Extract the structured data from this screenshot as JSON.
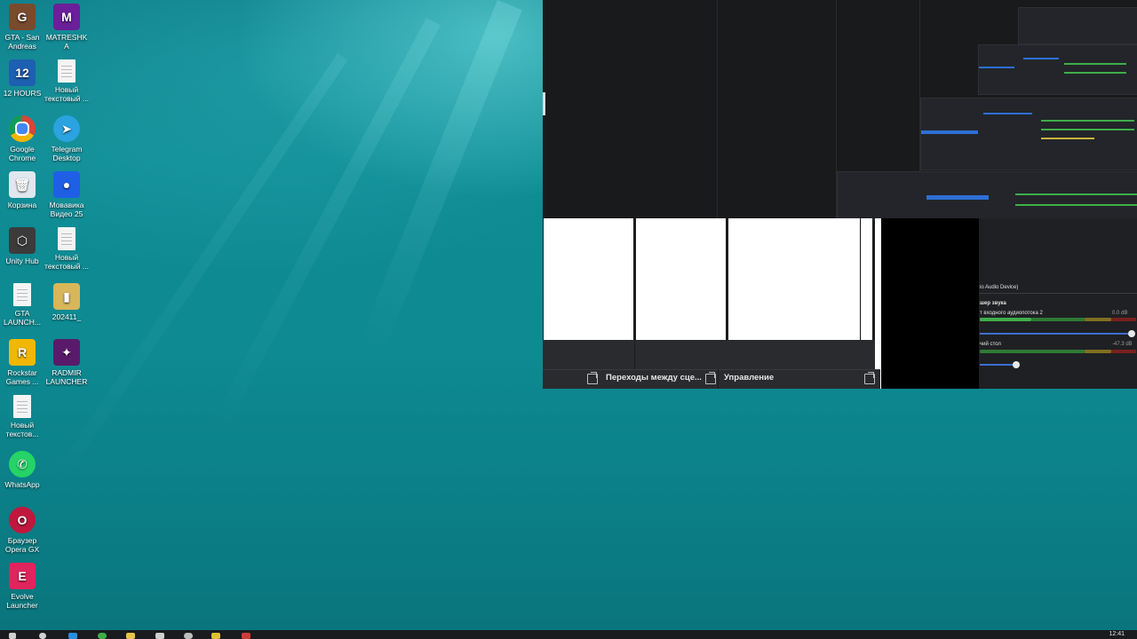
{
  "desktop": {
    "icons": [
      {
        "label": "GTA - San Andreas",
        "icon": "gta-sa-icon",
        "color": "#7a4a2e",
        "glyph": "G"
      },
      {
        "label": "MATRESHKA",
        "icon": "matreshka-icon",
        "color": "#6b1f9a",
        "glyph": "M"
      },
      {
        "label": "12 HOURS",
        "icon": "12-hours-icon",
        "color": "#1d5fb0",
        "glyph": "12"
      },
      {
        "label": "Новый текстовый ...",
        "icon": "text-file-icon",
        "color": "#f4f4f4",
        "glyph": ""
      },
      {
        "label": "Google Chrome",
        "icon": "chrome-icon",
        "color": "#db4437",
        "glyph": ""
      },
      {
        "label": "Telegram Desktop",
        "icon": "telegram-icon",
        "color": "#2aa3e0",
        "glyph": "➤"
      },
      {
        "label": "Корзина",
        "icon": "recycle-bin-icon",
        "color": "#dfe8ef",
        "glyph": "🗑"
      },
      {
        "label": "Мовавика Видео 25",
        "icon": "movavi-icon",
        "color": "#1f5fe6",
        "glyph": "●"
      },
      {
        "label": "Unity Hub",
        "icon": "unity-hub-icon",
        "color": "#3b3b3b",
        "glyph": "⬡"
      },
      {
        "label": "Новый текстовый ...",
        "icon": "text-file-icon",
        "color": "#f4f4f4",
        "glyph": ""
      },
      {
        "label": "GTA LAUNCH...",
        "icon": "file-icon",
        "color": "#f4f4f4",
        "glyph": ""
      },
      {
        "label": "202411_",
        "icon": "archive-icon",
        "color": "#d8b65a",
        "glyph": "▮"
      },
      {
        "label": "Rockstar Games ...",
        "icon": "rockstar-icon",
        "color": "#f2b705",
        "glyph": "R"
      },
      {
        "label": "RADMIR LAUNCHER",
        "icon": "radmir-icon",
        "color": "#5a1a6b",
        "glyph": "✦"
      },
      {
        "label": "Новый текстов...",
        "icon": "text-file-icon",
        "color": "#f4f4f4",
        "glyph": ""
      },
      {
        "label": "WhatsApp",
        "icon": "whatsapp-icon",
        "color": "#25d366",
        "glyph": "✆"
      },
      {
        "label": "Браузер Opera GX",
        "icon": "opera-gx-icon",
        "color": "#c0173e",
        "glyph": "O"
      },
      {
        "label": "Evolve Launcher",
        "icon": "evolve-icon",
        "color": "#e0245e",
        "glyph": "E"
      }
    ]
  },
  "obs": {
    "dock_transitions_title": "Переходы между сце...",
    "dock_controls_title": "Управление",
    "mixer_device_label": "io Audio Device)",
    "mixer_title": "шер звука",
    "mixer_track1": "т входного аудиопотока 2",
    "mixer_track2": "чий стол",
    "mixer_db1": "0.0 dB",
    "mixer_db2": "-47.3 dB"
  },
  "taskbar": {
    "clock": "12:41"
  }
}
